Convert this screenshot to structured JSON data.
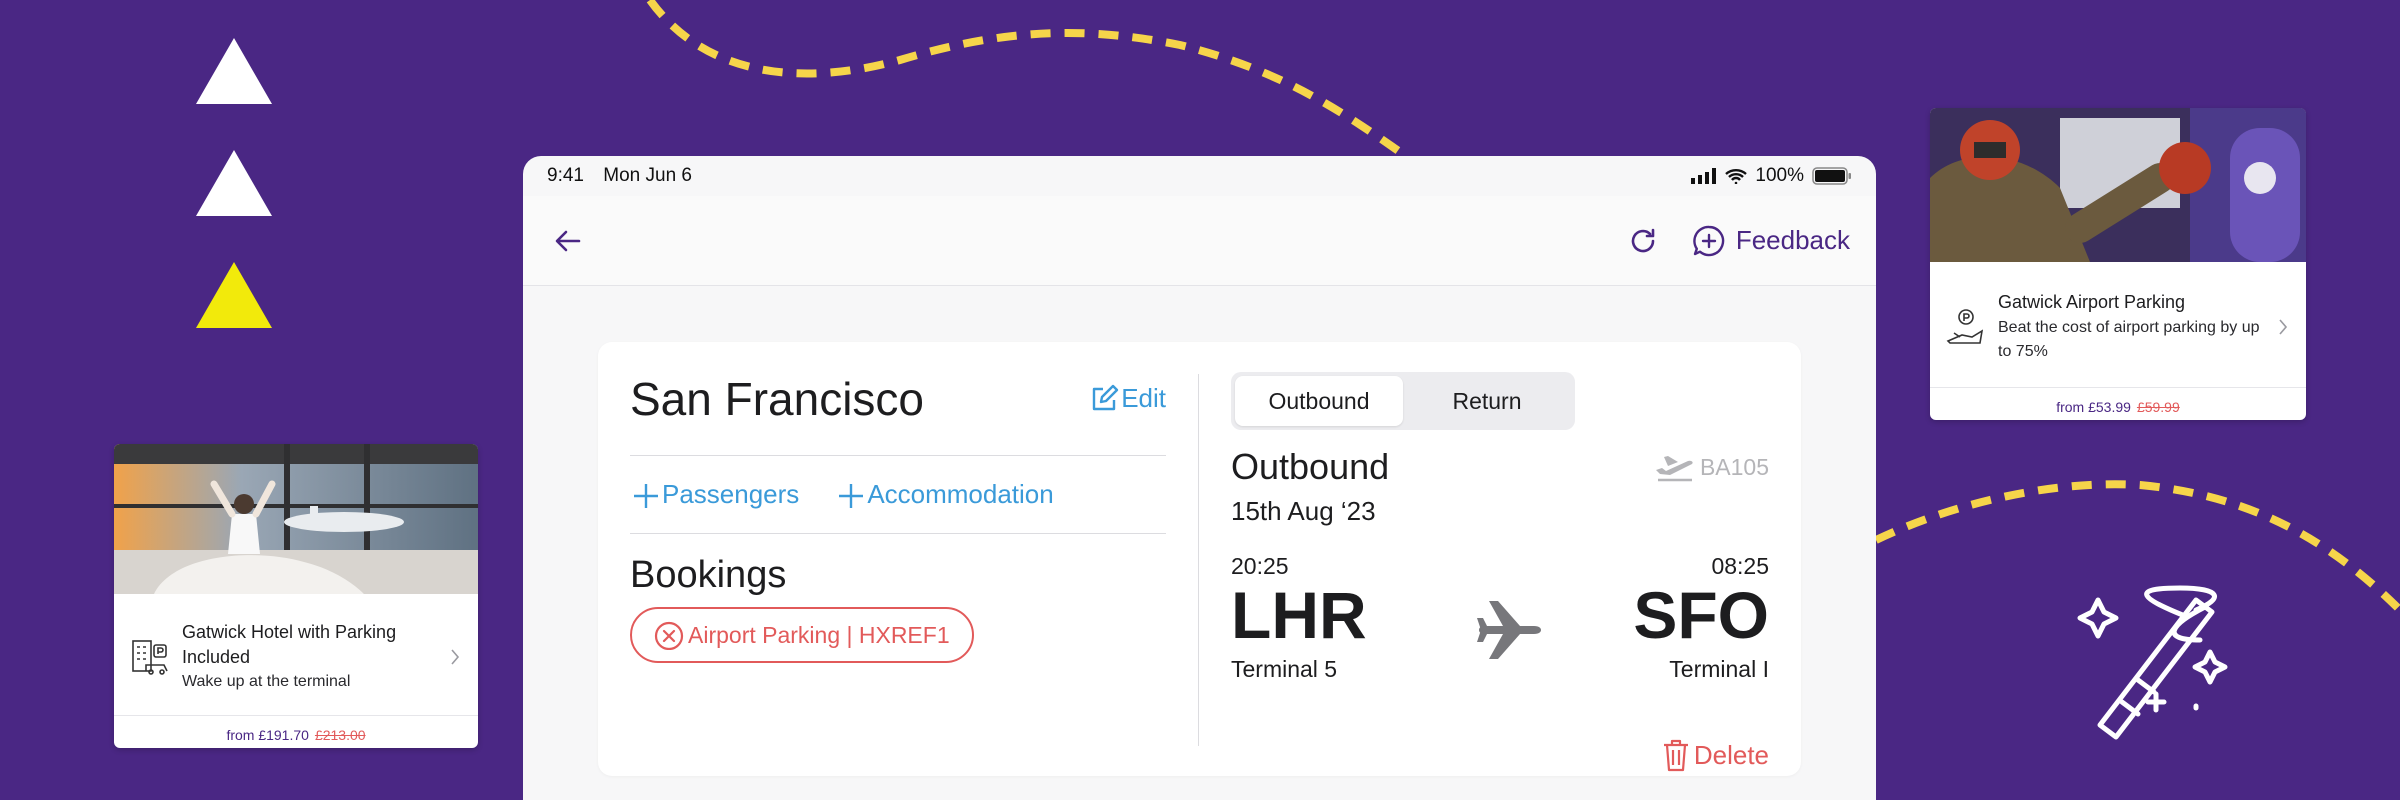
{
  "status_bar": {
    "time": "9:41",
    "date": "Mon Jun 6",
    "battery": "100%"
  },
  "nav": {
    "feedback_label": "Feedback"
  },
  "trip": {
    "city": "San Francisco",
    "edit_label": "Edit",
    "add_passengers_label": "Passengers",
    "add_accommodation_label": "Accommodation",
    "bookings_title": "Bookings",
    "booking_chip_label": "Airport Parking | HXREF1"
  },
  "flight": {
    "tabs": [
      {
        "label": "Outbound",
        "active": true
      },
      {
        "label": "Return",
        "active": false
      }
    ],
    "section_title": "Outbound",
    "flight_number": "BA105",
    "date": "15th Aug ‘23",
    "departure": {
      "time": "20:25",
      "code": "LHR",
      "terminal": "Terminal 5"
    },
    "arrival": {
      "time": "08:25",
      "code": "SFO",
      "terminal": "Terminal I"
    },
    "delete_label": "Delete"
  },
  "promo_hotel": {
    "title": "Gatwick Hotel with Parking Included",
    "subtitle": "Wake up at the terminal",
    "from_label": "from £191.70",
    "old_price": "£213.00"
  },
  "promo_parking": {
    "title": "Gatwick Airport Parking",
    "subtitle": "Beat the cost of airport parking by up to 75%",
    "from_label": "from £53.99",
    "old_price": "£59.99"
  },
  "colors": {
    "background": "#4a2784",
    "accent_blue": "#3a9ad9",
    "danger": "#e25a5a",
    "dash_yellow": "#f6d54a",
    "triangle_yellow": "#f2ea0b"
  },
  "icons": [
    "back-arrow-icon",
    "refresh-icon",
    "feedback-plus-icon",
    "edit-icon",
    "plus-icon",
    "close-circle-icon",
    "flight-takeoff-icon",
    "airplane-icon",
    "trash-icon",
    "hotel-icon",
    "parking-plane-icon",
    "chevron-right-icon",
    "magic-wand-icon",
    "signal-icon",
    "wifi-icon",
    "battery-icon"
  ]
}
